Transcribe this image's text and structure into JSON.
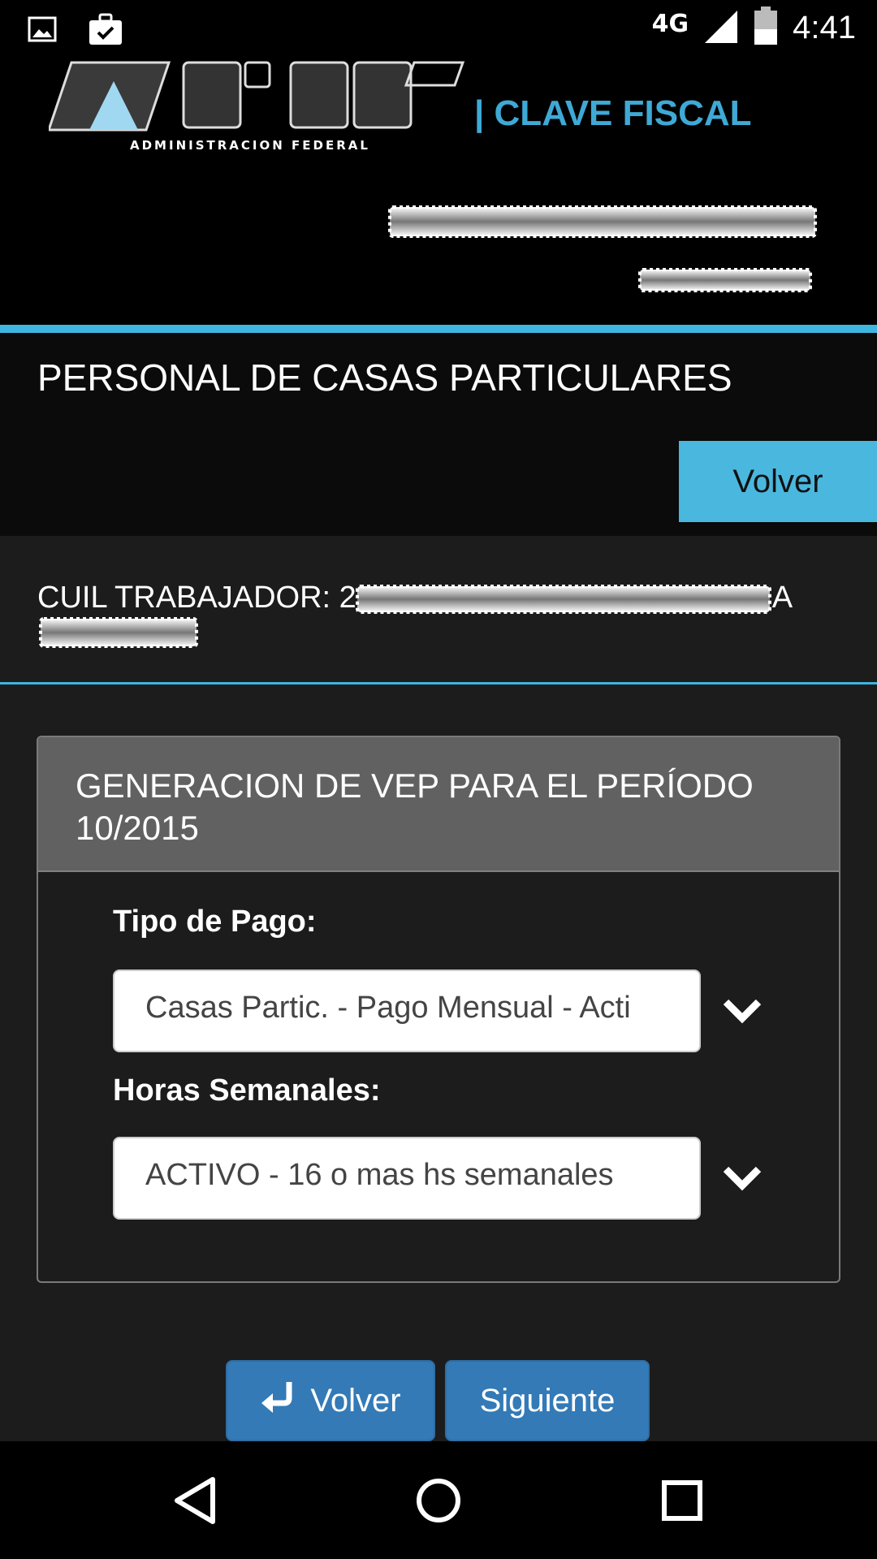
{
  "status_bar": {
    "network": "4G",
    "time": "4:41",
    "icons": [
      "image-icon",
      "briefcase-check-icon",
      "signal-icon",
      "battery-icon"
    ]
  },
  "header": {
    "logo_subtitle": "ADMINISTRACION FEDERAL",
    "brand": "| CLAVE FISCAL",
    "brand_color": "#3fa9d6"
  },
  "page": {
    "title": "PERSONAL DE CASAS PARTICULARES",
    "back_button": "Volver",
    "accent_color": "#3fb6e0"
  },
  "worker": {
    "cuil_label": "CUIL TRABAJADOR: 2",
    "cuil_suffix": "A"
  },
  "panel": {
    "title": "GENERACION DE VEP PARA EL PERÍODO 10/2015",
    "tipo_label": "Tipo de Pago:",
    "tipo_value": "Casas Partic. - Pago Mensual - Acti",
    "horas_label": "Horas Semanales:",
    "horas_value": "ACTIVO - 16 o mas hs semanales"
  },
  "actions": {
    "volver_label": "Volver",
    "siguiente_label": "Siguiente",
    "button_color": "#337ab7"
  },
  "nav": [
    "back-icon",
    "home-icon",
    "recents-icon"
  ]
}
